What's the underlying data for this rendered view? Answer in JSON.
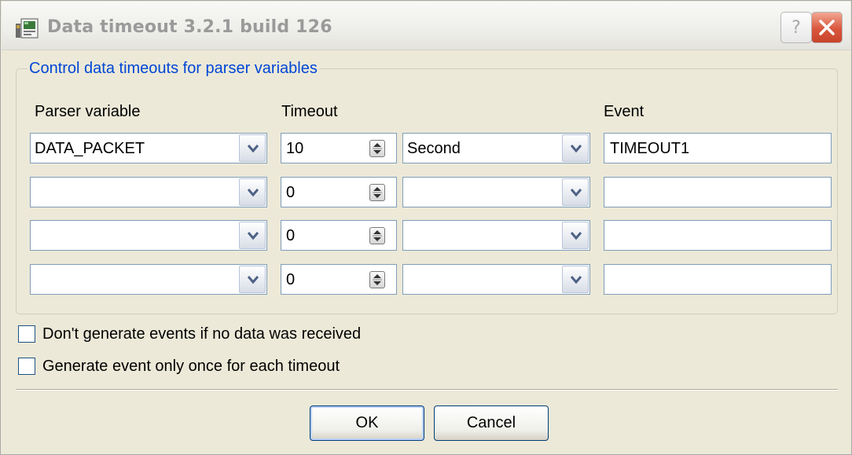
{
  "window": {
    "title": "Data timeout 3.2.1 build 126",
    "help_label": "?",
    "icons": [
      "app-icon",
      "help-icon",
      "close-icon"
    ]
  },
  "group": {
    "legend": "Control data timeouts for parser variables"
  },
  "columns": {
    "parser_variable": "Parser variable",
    "timeout": "Timeout",
    "event": "Event"
  },
  "rows": [
    {
      "variable": "DATA_PACKET",
      "timeout": "10",
      "unit": "Second",
      "event": "TIMEOUT1"
    },
    {
      "variable": "",
      "timeout": "0",
      "unit": "",
      "event": ""
    },
    {
      "variable": "",
      "timeout": "0",
      "unit": "",
      "event": ""
    },
    {
      "variable": "",
      "timeout": "0",
      "unit": "",
      "event": ""
    }
  ],
  "options": {
    "no_data_events": {
      "label": "Don't generate events if no data was received",
      "checked": false
    },
    "once_per_timeout": {
      "label": "Generate event only once for each timeout",
      "checked": false
    }
  },
  "buttons": {
    "ok": "OK",
    "cancel": "Cancel"
  },
  "colors": {
    "legend": "#0046d5",
    "face": "#ece9d8",
    "field_border": "#7f9db9",
    "close": "#d9573d"
  }
}
